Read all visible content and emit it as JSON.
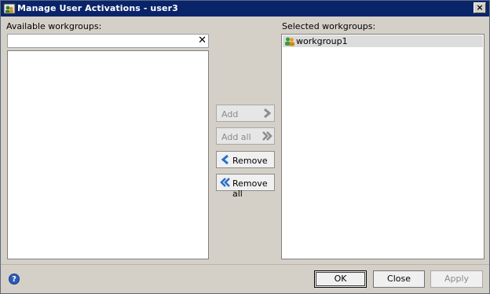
{
  "window": {
    "title": "Manage User Activations - user3",
    "close_glyph": "×"
  },
  "available": {
    "label": "Available workgroups:",
    "search_value": "",
    "clear_glyph": "✕",
    "items": []
  },
  "selected": {
    "label": "Selected workgroups:",
    "items": [
      {
        "label": "workgroup1",
        "icon": "workgroup-icon"
      }
    ]
  },
  "transfer": {
    "add": {
      "label": "Add",
      "enabled": false
    },
    "add_all": {
      "label": "Add all",
      "enabled": false
    },
    "remove": {
      "label": "Remove",
      "enabled": true
    },
    "remove_all": {
      "label": "Remove all",
      "enabled": true
    }
  },
  "footer": {
    "help_glyph": "?",
    "ok": {
      "label": "OK",
      "enabled": true
    },
    "close": {
      "label": "Close",
      "enabled": true
    },
    "apply": {
      "label": "Apply",
      "enabled": false
    }
  },
  "colors": {
    "titlebar": "#0a246a",
    "chevron_enabled": "#2a6fc9",
    "chevron_disabled": "#8c8c8c",
    "selected_row": "#dcdcdc"
  }
}
